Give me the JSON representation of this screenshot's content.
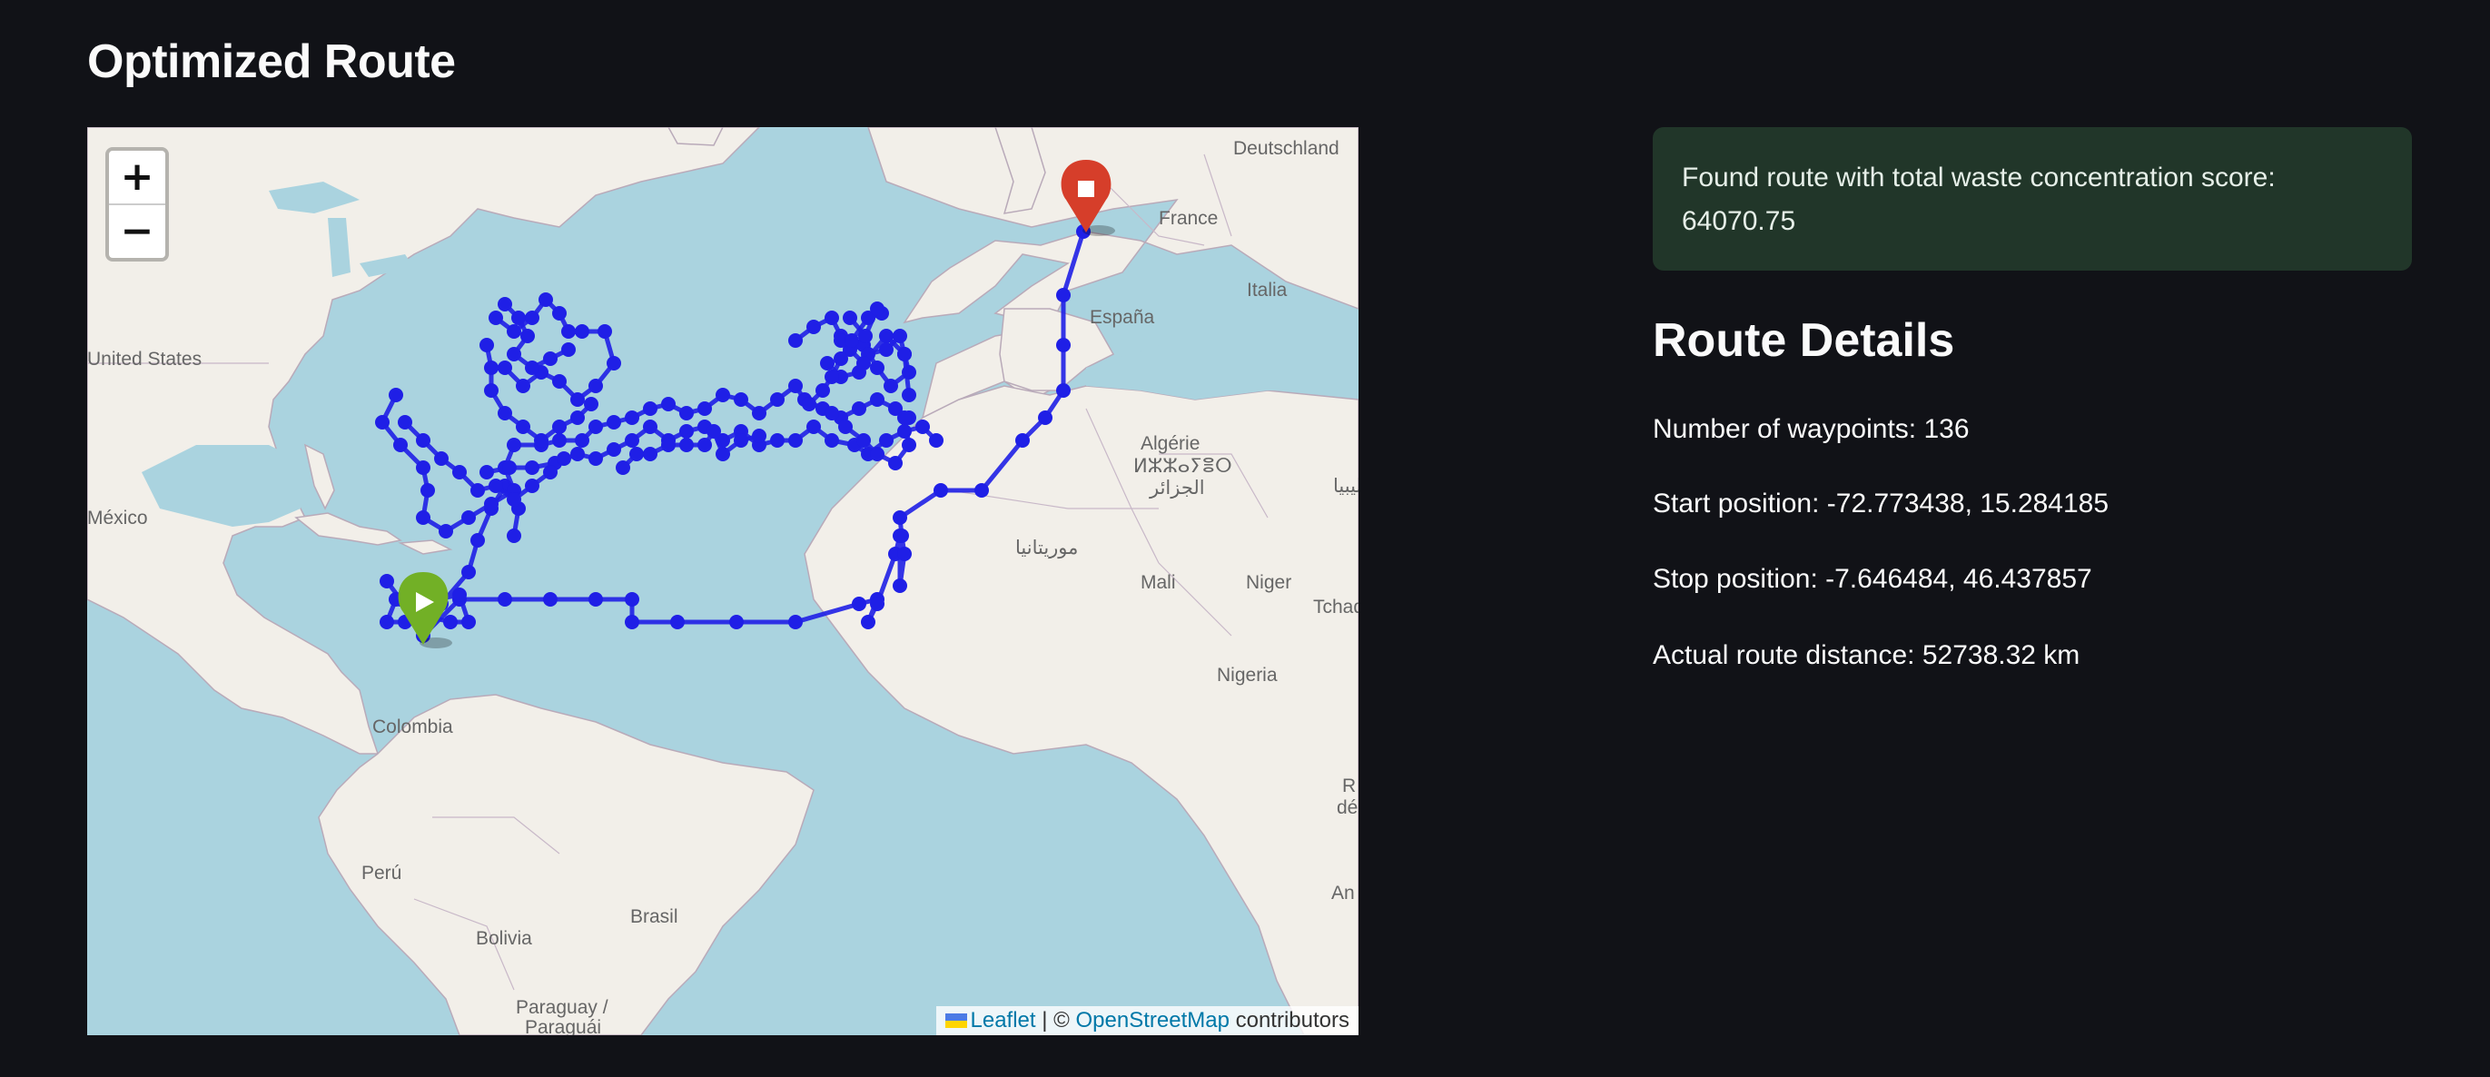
{
  "title": "Optimized Route",
  "map": {
    "zoom_in": "+",
    "zoom_out": "−",
    "labels": {
      "deutschland": "Deutschland",
      "france": "France",
      "italia": "Italia",
      "espana": "España",
      "united_states": "United States",
      "mexico": "México",
      "algerie": "Algérie",
      "algerie_tifinagh": "ⵍⵣⵣⴰⵢⴻⵔ",
      "algerie_arabic": "الجزائر",
      "mauritania_arabic": "موريتانيا",
      "mali": "Mali",
      "niger": "Niger",
      "tchad": "Tchad",
      "nigeria": "Nigeria",
      "colombia": "Colombia",
      "peru": "Perú",
      "brasil": "Brasil",
      "bolivia": "Bolivia",
      "paraguay": "Paraguay /",
      "paraguai": "Paraguái",
      "libya_arabic": "ليبيا",
      "edge_r": "R",
      "edge_de": "dé",
      "edge_an": "An"
    },
    "attribution": {
      "leaflet": "Leaflet",
      "separator": " | © ",
      "osm": "OpenStreetMap",
      "contributors": " contributors"
    },
    "route_color": "#1f1fe6",
    "start_marker_color": "#72b026",
    "end_marker_color": "#d63e2a"
  },
  "alert": {
    "text": "Found route with total waste concentration score: 64070.75",
    "background": "#213629"
  },
  "details": {
    "heading": "Route Details",
    "waypoints": "Number of waypoints: 136",
    "start": "Start position: -72.773438, 15.284185",
    "stop": "Stop position: -7.646484, 46.437857",
    "distance": "Actual route distance: 52738.32 km"
  }
}
